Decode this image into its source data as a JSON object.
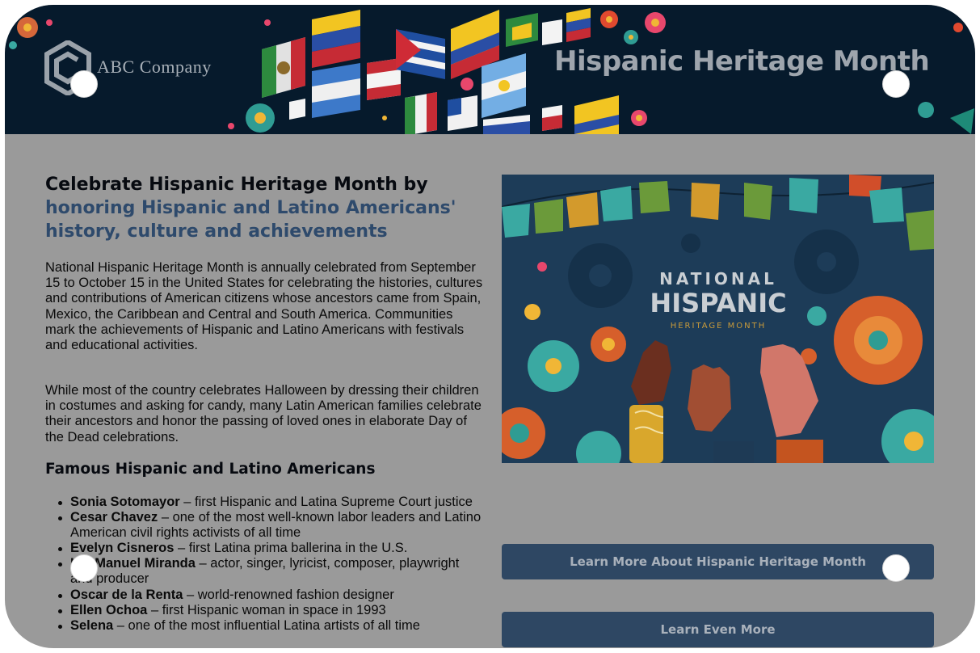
{
  "banner": {
    "logo_text": "ABC Company",
    "title": "Hispanic Heritage Month"
  },
  "content": {
    "heading_line1": "Celebrate Hispanic Heritage Month by",
    "heading_line2": "honoring Hispanic and Latino Americans' history, culture and achievements",
    "paragraph1": "National Hispanic Heritage Month is annually celebrated from September 15 to October 15 in the United States for celebrating the histories, cultures and contributions of American citizens whose ancestors came from Spain, Mexico, the Caribbean and Central and South America. Communities mark the achievements of Hispanic and Latino Americans with festivals and educational activities.",
    "paragraph2": "While most of the country celebrates Halloween by dressing their children in costumes and asking for candy, many Latin American families celebrate their ancestors and honor the passing of loved ones in elaborate Day of the Dead celebrations.",
    "section_title": "Famous Hispanic and Latino Americans",
    "people": [
      {
        "name": "Sonia Sotomayor",
        "desc": " – first Hispanic and Latina Supreme Court justice"
      },
      {
        "name": "Cesar Chavez",
        "desc": " – one of the most well-known labor leaders and Latino American civil rights activists of all time"
      },
      {
        "name": "Evelyn Cisneros",
        "desc": " – first Latina prima ballerina in the U.S."
      },
      {
        "name": "Lin-Manuel Miranda",
        "desc": " – actor, singer, lyricist, composer, playwright and producer"
      },
      {
        "name": "Oscar de la Renta",
        "desc": " – world-renowned fashion designer"
      },
      {
        "name": "Ellen Ochoa",
        "desc": " – first Hispanic woman in space in 1993"
      },
      {
        "name": "Selena",
        "desc": " – one of the most influential Latina artists of all time"
      }
    ]
  },
  "hero_image": {
    "line1": "NATIONAL",
    "line2": "HISPANIC",
    "line3": "HERITAGE MONTH"
  },
  "buttons": {
    "learn_more": "Learn More About Hispanic Heritage Month",
    "learn_even_more": "Learn Even More"
  },
  "colors": {
    "banner_bg": "#061a2c",
    "accent_heading": "#2e4a6c",
    "button_bg": "#2e4763",
    "page_overlay": "#9a9a9a"
  }
}
